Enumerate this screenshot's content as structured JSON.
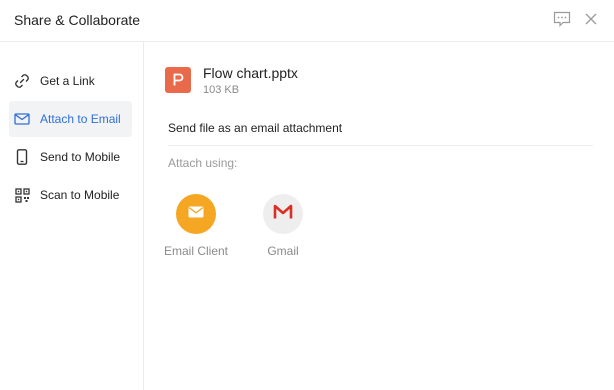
{
  "window": {
    "title": "Share & Collaborate",
    "feedback_icon": "feedback-icon",
    "close_icon": "close-icon"
  },
  "sidebar": {
    "active_color": "#2f6fd6",
    "items": [
      {
        "label": "Get a Link",
        "icon": "link-icon",
        "active": false
      },
      {
        "label": "Attach to Email",
        "icon": "mail-icon",
        "active": true
      },
      {
        "label": "Send to Mobile",
        "icon": "mobile-icon",
        "active": false
      },
      {
        "label": "Scan to Mobile",
        "icon": "qr-code-icon",
        "active": false
      }
    ]
  },
  "file": {
    "name": "Flow chart.pptx",
    "size": "103 KB",
    "icon": "presentation-file-icon",
    "icon_color": "#e96a4a"
  },
  "main": {
    "section_title": "Send file as an email attachment",
    "attach_label": "Attach using:",
    "options": [
      {
        "label": "Email Client",
        "icon": "envelope-icon",
        "color": "#f5a623"
      },
      {
        "label": "Gmail",
        "icon": "gmail-icon",
        "color": "#d93025"
      }
    ]
  }
}
